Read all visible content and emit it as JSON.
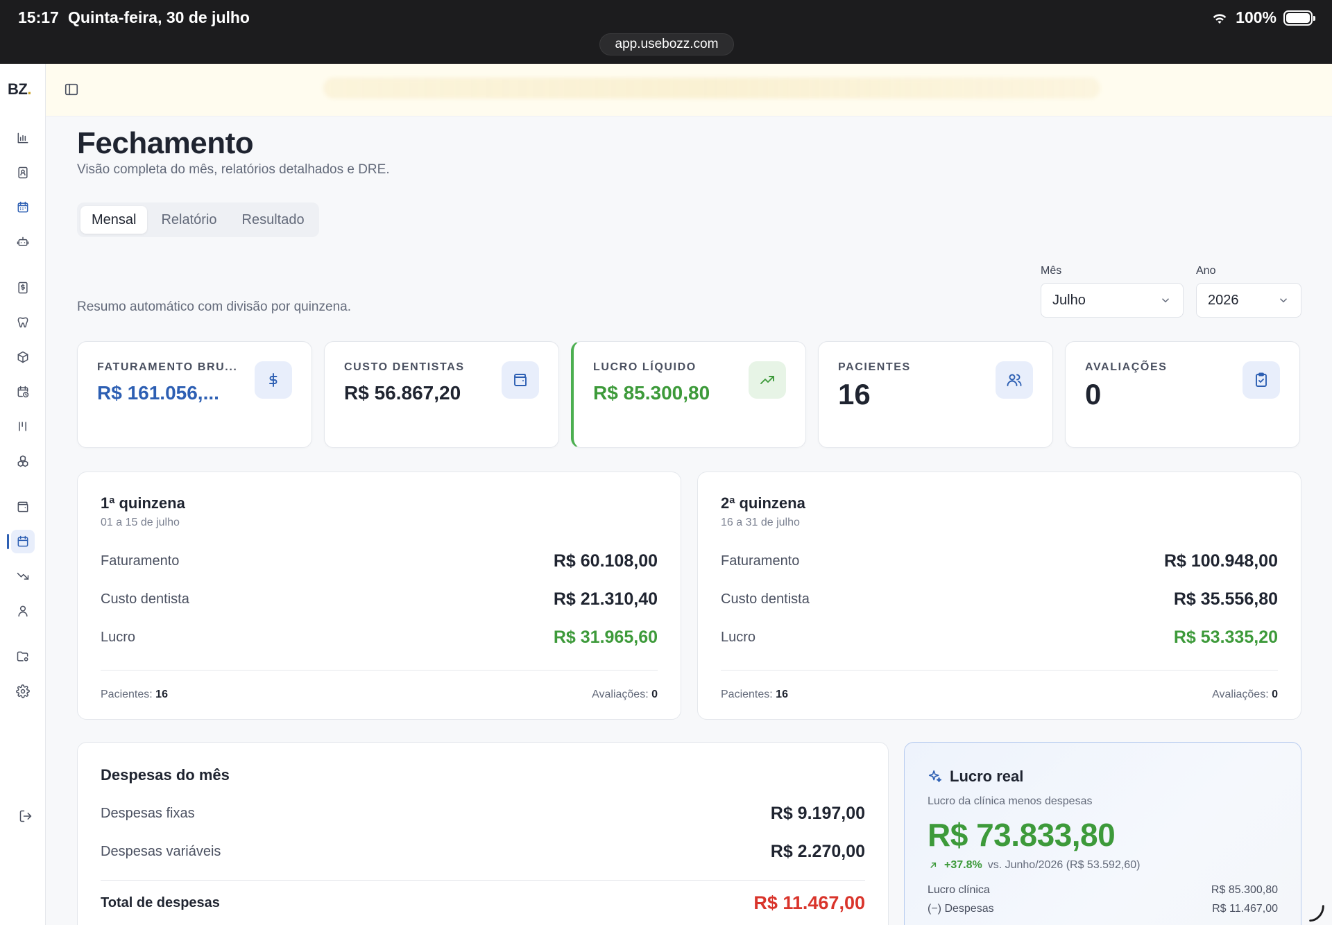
{
  "status_bar": {
    "time": "15:17",
    "date": "Quinta-feira, 30 de julho",
    "battery": "100%",
    "url": "app.usebozz.com"
  },
  "brand": {
    "logo": "BZ",
    "logo_dot": "."
  },
  "sidebar": {
    "icons": [
      "chart-icon",
      "contacts-icon",
      "calendar-icon",
      "robot-icon",
      "invoice-icon",
      "tooth-icon",
      "box-icon",
      "calendar-clock-icon",
      "columns-icon",
      "cubes-icon",
      "wallet-icon",
      "calendar-icon",
      "trending-down-icon",
      "user-icon",
      "folder-settings-icon",
      "gear-icon",
      "logout-icon"
    ]
  },
  "page": {
    "title": "Fechamento",
    "subtitle": "Visão completa do mês, relatórios detalhados e DRE.",
    "tabs": [
      {
        "label": "Mensal"
      },
      {
        "label": "Relatório"
      },
      {
        "label": "Resultado"
      }
    ],
    "summary": "Resumo automático com divisão por quinzena."
  },
  "filters": {
    "month_label": "Mês",
    "month_value": "Julho",
    "year_label": "Ano",
    "year_value": "2026"
  },
  "kpis": [
    {
      "label": "FATURAMENTO BRU...",
      "value": "R$ 161.056,...",
      "icon": "dollar-icon"
    },
    {
      "label": "CUSTO DENTISTAS",
      "value": "R$ 56.867,20",
      "icon": "wallet-icon"
    },
    {
      "label": "LUCRO LÍQUIDO",
      "value": "R$ 85.300,80",
      "icon": "trending-up-icon"
    },
    {
      "label": "PACIENTES",
      "value": "16",
      "icon": "users-icon"
    },
    {
      "label": "AVALIAÇÕES",
      "value": "0",
      "icon": "clipboard-check-icon"
    }
  ],
  "quinzenas": [
    {
      "title": "1ª quinzena",
      "range": "01 a 15 de julho",
      "rows": [
        {
          "label": "Faturamento",
          "value": "R$ 60.108,00"
        },
        {
          "label": "Custo dentista",
          "value": "R$ 21.310,40"
        },
        {
          "label": "Lucro",
          "value": "R$ 31.965,60"
        }
      ],
      "patients_label": "Pacientes:",
      "patients": "16",
      "evals_label": "Avaliações:",
      "evals": "0"
    },
    {
      "title": "2ª quinzena",
      "range": "16 a 31 de julho",
      "rows": [
        {
          "label": "Faturamento",
          "value": "R$ 100.948,00"
        },
        {
          "label": "Custo dentista",
          "value": "R$ 35.556,80"
        },
        {
          "label": "Lucro",
          "value": "R$ 53.335,20"
        }
      ],
      "patients_label": "Pacientes:",
      "patients": "16",
      "evals_label": "Avaliações:",
      "evals": "0"
    }
  ],
  "expenses": {
    "title": "Despesas do mês",
    "fixed_label": "Despesas fixas",
    "fixed_value": "R$ 9.197,00",
    "variable_label": "Despesas variáveis",
    "variable_value": "R$ 2.270,00",
    "total_label": "Total de despesas",
    "total_value": "R$ 11.467,00"
  },
  "lucro_real": {
    "title": "Lucro real",
    "subtitle": "Lucro da clínica menos despesas",
    "value": "R$ 73.833,80",
    "growth": "+37.8%",
    "comparison": "vs. Junho/2026 (R$ 53.592,60)",
    "clinic_label": "Lucro clínica",
    "clinic_value": "R$ 85.300,80",
    "expenses_label": "(−) Despesas",
    "expenses_value": "R$ 11.467,00"
  },
  "colors": {
    "primary": "#2d5fb3",
    "positive": "#3d9a3a",
    "negative": "#d9342b",
    "brand_dot": "#c9a227"
  }
}
